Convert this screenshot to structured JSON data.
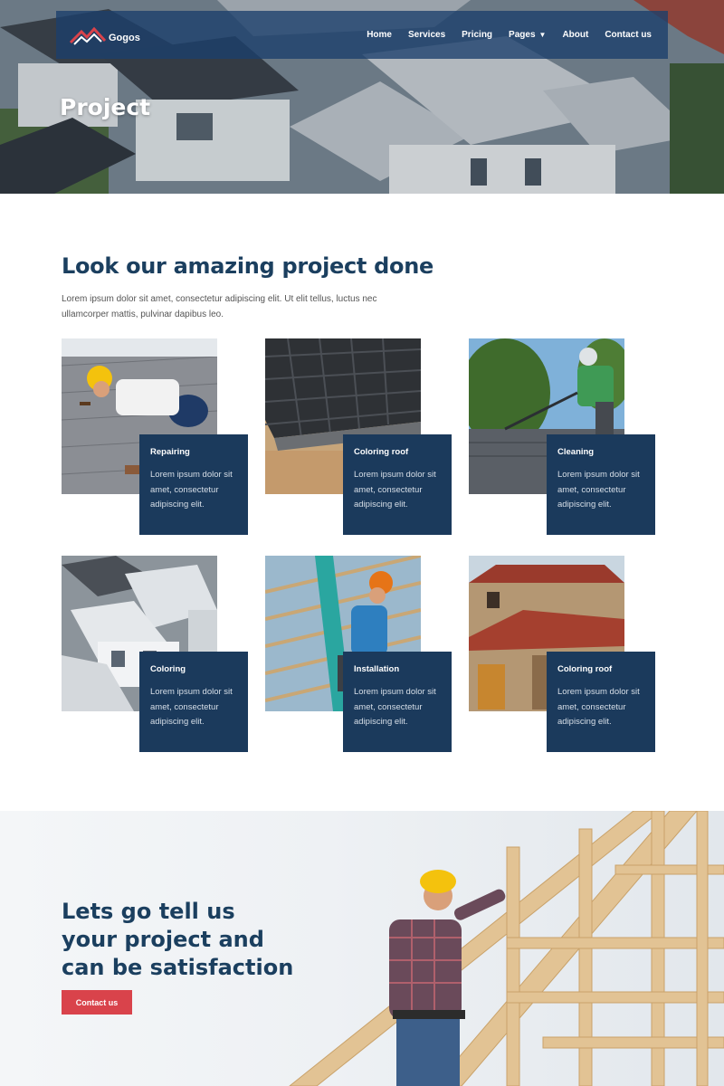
{
  "brand": {
    "name": "Gogos",
    "accent": "#d9434b",
    "navy": "#1b3a5c"
  },
  "nav": {
    "items": [
      {
        "label": "Home"
      },
      {
        "label": "Services"
      },
      {
        "label": "Pricing"
      },
      {
        "label": "Pages",
        "icon": "chevron-down-icon"
      },
      {
        "label": "About"
      },
      {
        "label": "Contact us"
      }
    ]
  },
  "hero": {
    "title": "Project"
  },
  "projects": {
    "title": "Look our amazing project done",
    "description": "Lorem ipsum dolor sit amet, consectetur adipiscing elit. Ut elit tellus, luctus nec ullamcorper mattis, pulvinar dapibus leo.",
    "items": [
      {
        "title": "Repairing",
        "text": "Lorem ipsum dolor sit amet, consectetur adipiscing elit."
      },
      {
        "title": "Coloring roof",
        "text": "Lorem ipsum dolor sit amet, consectetur adipiscing elit."
      },
      {
        "title": "Cleaning",
        "text": "Lorem ipsum dolor sit amet, consectetur adipiscing elit."
      },
      {
        "title": "Coloring",
        "text": "Lorem ipsum dolor sit amet, consectetur adipiscing elit."
      },
      {
        "title": "Installation",
        "text": "Lorem ipsum dolor sit amet, consectetur adipiscing elit."
      },
      {
        "title": "Coloring roof",
        "text": "Lorem ipsum dolor sit amet, consectetur adipiscing elit."
      }
    ]
  },
  "cta": {
    "title": "Lets go tell us your project and can be satisfaction",
    "button_label": "Contact us"
  }
}
